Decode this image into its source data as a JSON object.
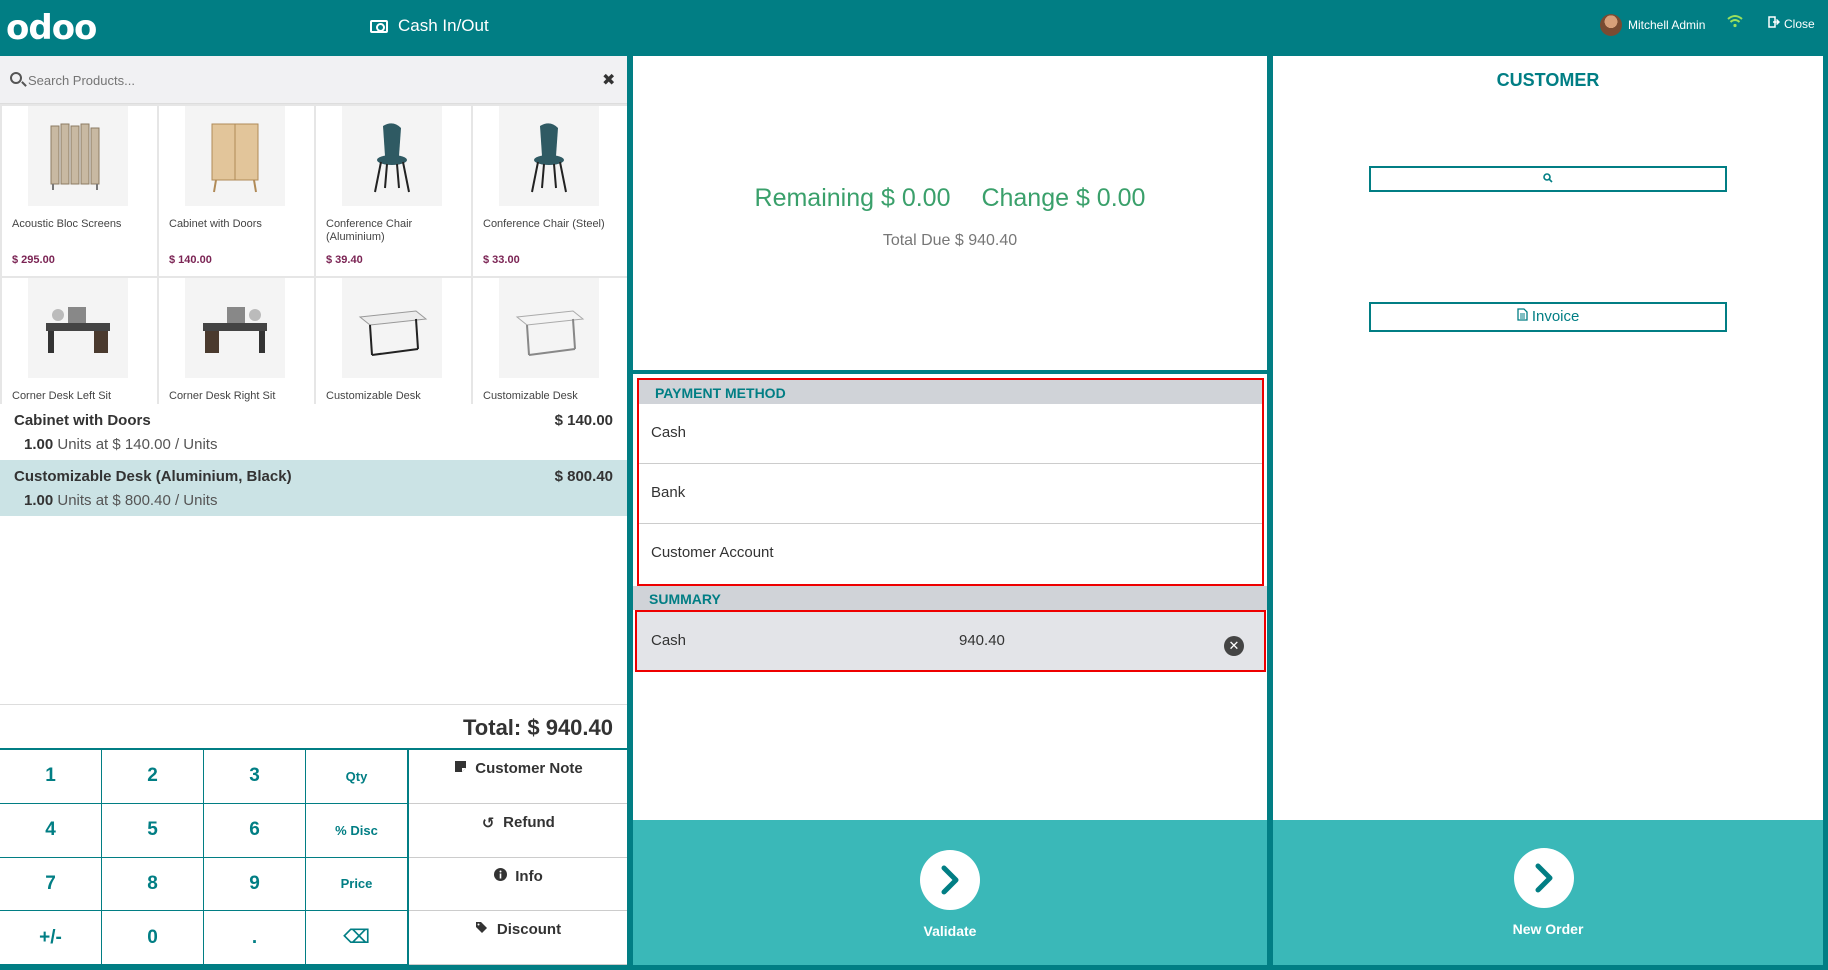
{
  "topbar": {
    "logo": "odoo",
    "cash_in_out": "Cash In/Out",
    "user_name": "Mitchell Admin",
    "close_label": "Close"
  },
  "search": {
    "placeholder": "Search Products..."
  },
  "products": [
    {
      "name": "Acoustic Bloc Screens",
      "price": "$ 295.00",
      "icon": "screen-icon"
    },
    {
      "name": "Cabinet with Doors",
      "price": "$ 140.00",
      "icon": "cabinet-icon"
    },
    {
      "name": "Conference Chair (Aluminium)",
      "price": "$ 39.40",
      "icon": "chair-icon"
    },
    {
      "name": "Conference Chair (Steel)",
      "price": "$ 33.00",
      "icon": "chair-icon"
    },
    {
      "name": "Corner Desk Left Sit",
      "price": "",
      "icon": "desk-icon"
    },
    {
      "name": "Corner Desk Right Sit",
      "price": "",
      "icon": "desk-icon"
    },
    {
      "name": "Customizable Desk",
      "price": "",
      "icon": "table-icon"
    },
    {
      "name": "Customizable Desk",
      "price": "",
      "icon": "table-icon"
    }
  ],
  "order": {
    "lines": [
      {
        "name": "Cabinet with Doors",
        "price": "$ 140.00",
        "qty": "1.00",
        "detail": "Units at $ 140.00 / Units",
        "selected": false
      },
      {
        "name": "Customizable Desk (Aluminium, Black)",
        "price": "$ 800.40",
        "qty": "1.00",
        "detail": "Units at $ 800.40 / Units",
        "selected": true
      }
    ],
    "total": "Total: $ 940.40"
  },
  "numpad": [
    "1",
    "2",
    "3",
    "Qty",
    "4",
    "5",
    "6",
    "% Disc",
    "7",
    "8",
    "9",
    "Price",
    "+/-",
    "0",
    ".",
    "⌫"
  ],
  "controls": {
    "customer_note": "Customer Note",
    "refund": "Refund",
    "info": "Info",
    "discount": "Discount"
  },
  "payment": {
    "remaining": "Remaining $ 0.00",
    "change": "Change $ 0.00",
    "total_due": "Total Due  $ 940.40",
    "method_header": "PAYMENT METHOD",
    "methods": [
      "Cash",
      "Bank",
      "Customer Account"
    ],
    "summary_header": "SUMMARY",
    "summary_line": {
      "method": "Cash",
      "amount": "940.40"
    },
    "validate": "Validate"
  },
  "customer": {
    "header": "CUSTOMER",
    "invoice": "Invoice",
    "new_order": "New Order"
  },
  "colors": {
    "primary": "#017e84",
    "accent_button": "#3ab8b8",
    "positive": "#3aa06b",
    "highlight": "#e00000"
  }
}
